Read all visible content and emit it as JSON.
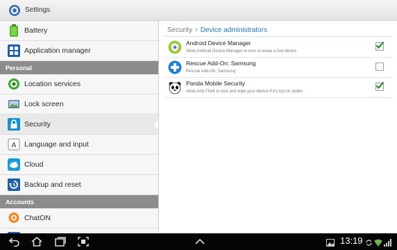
{
  "titlebar": {
    "title": "Settings",
    "icon": "settings-gear-icon"
  },
  "sidebar": {
    "sections": [
      {
        "type": "item",
        "label": "Battery",
        "icon": "battery-icon",
        "selected": false
      },
      {
        "type": "item",
        "label": "Application manager",
        "icon": "app-grid-icon",
        "selected": false
      },
      {
        "type": "header",
        "label": "Personal"
      },
      {
        "type": "item",
        "label": "Location services",
        "icon": "location-icon",
        "selected": false
      },
      {
        "type": "item",
        "label": "Lock screen",
        "icon": "lock-screen-icon",
        "selected": false
      },
      {
        "type": "item",
        "label": "Security",
        "icon": "padlock-icon",
        "selected": true
      },
      {
        "type": "item",
        "label": "Language and input",
        "icon": "keyboard-a-icon",
        "selected": false
      },
      {
        "type": "item",
        "label": "Cloud",
        "icon": "cloud-icon",
        "selected": false
      },
      {
        "type": "item",
        "label": "Backup and reset",
        "icon": "backup-icon",
        "selected": false
      },
      {
        "type": "header",
        "label": "Accounts"
      },
      {
        "type": "item",
        "label": "ChatON",
        "icon": "chaton-icon",
        "selected": false
      }
    ]
  },
  "content": {
    "breadcrumb": {
      "parent": "Security",
      "separator": "›",
      "current": "Device administrators"
    },
    "admins": [
      {
        "name": "Android Device Manager",
        "description": "Allow Android Device Manager to lock or erase a lost device",
        "icon": "android-device-manager-icon",
        "checked": true
      },
      {
        "name": "Rescue Add-On: Samsung",
        "description": "Rescue Add-On: Samsung",
        "icon": "rescue-plus-icon",
        "checked": false
      },
      {
        "name": "Panda Mobile Security",
        "description": "Allow Anti-Theft to lock and wipe your device if it's lost or stolen",
        "icon": "panda-icon",
        "checked": true
      }
    ]
  },
  "systembar": {
    "time": "13:19",
    "nav_icons": [
      "back-icon",
      "home-icon",
      "recent-apps-icon",
      "screenshot-icon",
      "up-chevron-icon"
    ],
    "status_icons": [
      "gallery-icon",
      "sync-icon",
      "wifi-icon",
      "signal-icon"
    ]
  },
  "colors": {
    "accent": "#1f77b4",
    "header_bg": "#8c8c8c",
    "check_green": "#2e8b2e",
    "system_bar": "#050505"
  }
}
